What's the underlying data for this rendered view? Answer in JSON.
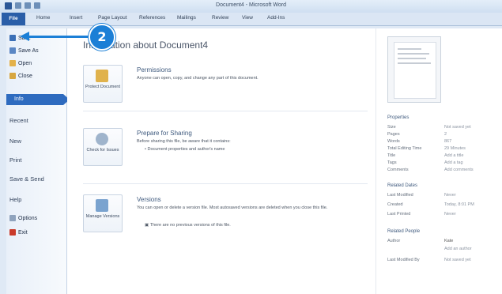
{
  "window": {
    "title": "Document4 - Microsoft Word"
  },
  "ribbon_tabs": [
    "File",
    "Home",
    "Insert",
    "Page Layout",
    "References",
    "Mailings",
    "Review",
    "View",
    "Add-Ins"
  ],
  "backstage_menu": {
    "items": [
      {
        "label": "Save",
        "icon": "save-icon"
      },
      {
        "label": "Save As",
        "icon": "save-as-icon"
      },
      {
        "label": "Open",
        "icon": "open-folder-icon"
      },
      {
        "label": "Close",
        "icon": "close-document-icon"
      },
      {
        "label": "Info",
        "selected": true
      },
      {
        "label": "Recent"
      },
      {
        "label": "New"
      },
      {
        "label": "Print"
      },
      {
        "label": "Save & Send"
      },
      {
        "label": "Help"
      },
      {
        "label": "Options",
        "icon": "options-icon"
      },
      {
        "label": "Exit",
        "icon": "exit-icon"
      }
    ]
  },
  "info": {
    "heading": "Information about Document4",
    "permissions": {
      "button_label": "Protect Document",
      "title": "Permissions",
      "description": "Anyone can open, copy, and change any part of this document."
    },
    "prepare": {
      "button_label": "Check for Issues",
      "title": "Prepare for Sharing",
      "description": "Before sharing this file, be aware that it contains:",
      "bullet": "Document properties and author's name"
    },
    "versions": {
      "button_label": "Manage Versions",
      "title": "Versions",
      "description": "You can open or delete a version file. Most autosaved versions are deleted when you close this file.",
      "bullet": "There are no previous versions of this file."
    }
  },
  "properties": {
    "header": "Properties",
    "rows": [
      {
        "label": "Size",
        "value": "Not saved yet"
      },
      {
        "label": "Pages",
        "value": "2"
      },
      {
        "label": "Words",
        "value": "867"
      },
      {
        "label": "Total Editing Time",
        "value": "29 Minutes"
      },
      {
        "label": "Title",
        "value": "Add a title"
      },
      {
        "label": "Tags",
        "value": "Add a tag"
      },
      {
        "label": "Comments",
        "value": "Add comments"
      }
    ],
    "related_dates_header": "Related Dates",
    "dates": [
      {
        "label": "Last Modified",
        "value": "Never"
      },
      {
        "label": "Created",
        "value": "Today, 8:01 PM"
      },
      {
        "label": "Last Printed",
        "value": "Never"
      }
    ],
    "related_people_header": "Related People",
    "people": [
      {
        "label": "Author",
        "value": "Kate"
      },
      {
        "label": "",
        "value": "Add an author"
      },
      {
        "label": "Last Modified By",
        "value": "Not saved yet"
      }
    ]
  },
  "callout": {
    "step": "2"
  },
  "colors": {
    "accent": "#2e6bbf",
    "callout": "#1b7fd6"
  }
}
